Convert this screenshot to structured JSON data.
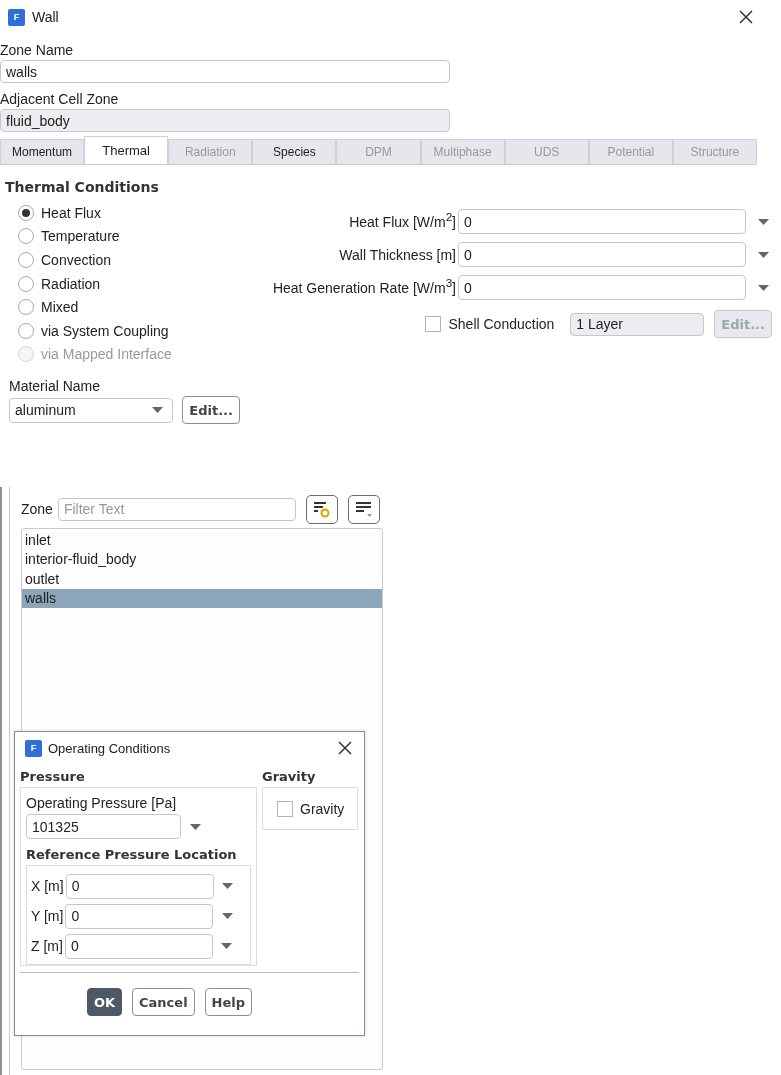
{
  "wall_dialog": {
    "logo": "F",
    "title": "Wall",
    "zone_name": {
      "label": "Zone Name",
      "value": "walls",
      "readonly": false
    },
    "adjacent_cell_zone": {
      "label": "Adjacent Cell Zone",
      "value": "fluid_body",
      "readonly": true
    },
    "tabs": [
      {
        "label": "Momentum",
        "selected": false,
        "disabled": false
      },
      {
        "label": "Thermal",
        "selected": true,
        "disabled": false
      },
      {
        "label": "Radiation",
        "selected": false,
        "disabled": true
      },
      {
        "label": "Species",
        "selected": false,
        "disabled": false
      },
      {
        "label": "DPM",
        "selected": false,
        "disabled": true
      },
      {
        "label": "Multiphase",
        "selected": false,
        "disabled": true
      },
      {
        "label": "UDS",
        "selected": false,
        "disabled": true
      },
      {
        "label": "Potential",
        "selected": false,
        "disabled": true
      },
      {
        "label": "Structure",
        "selected": false,
        "disabled": true
      }
    ],
    "section_title": "Thermal Conditions",
    "conditions": [
      {
        "label": "Heat Flux",
        "selected": true,
        "disabled": false
      },
      {
        "label": "Temperature",
        "selected": false,
        "disabled": false
      },
      {
        "label": "Convection",
        "selected": false,
        "disabled": false
      },
      {
        "label": "Radiation",
        "selected": false,
        "disabled": false
      },
      {
        "label": "Mixed",
        "selected": false,
        "disabled": false
      },
      {
        "label": "via System Coupling",
        "selected": false,
        "disabled": false
      },
      {
        "label": "via Mapped Interface",
        "selected": false,
        "disabled": true
      }
    ],
    "parameters": [
      {
        "label": "Heat Flux [W/m$^{2}$]",
        "value": "0"
      },
      {
        "label": "Wall Thickness [m]",
        "value": "0"
      },
      {
        "label": "Heat Generation Rate [W/m$^{3}$]",
        "value": "0"
      }
    ],
    "shell_conduction": {
      "label": "Shell Conduction",
      "checked": false,
      "layers": "1 Layer",
      "edit_button": {
        "label": "Edit...",
        "disabled": true
      }
    },
    "material": {
      "label": "Material Name",
      "value": "aluminum",
      "edit_button": {
        "label": "Edit...",
        "disabled": false
      }
    }
  },
  "zone_panel": {
    "label": "Zone",
    "filter_placeholder": "Filter Text",
    "items": [
      {
        "label": "inlet",
        "selected": false
      },
      {
        "label": "interior-fluid_body",
        "selected": false
      },
      {
        "label": "outlet",
        "selected": false
      },
      {
        "label": "walls",
        "selected": true
      }
    ]
  },
  "operating_conditions": {
    "logo": "F",
    "title": "Operating Conditions",
    "pressure_title": "Pressure",
    "operating_pressure": {
      "label": "Operating Pressure [Pa]",
      "value": "101325"
    },
    "reference_title": "Reference Pressure Location",
    "coordinates": [
      {
        "label": "X [m]",
        "value": "0"
      },
      {
        "label": "Y [m]",
        "value": "0"
      },
      {
        "label": "Z [m]",
        "value": "0"
      }
    ],
    "gravity_title": "Gravity",
    "gravity": {
      "label": "Gravity",
      "checked": false
    },
    "buttons": [
      {
        "label": "OK",
        "kind": "primary"
      },
      {
        "label": "Cancel",
        "kind": "default"
      },
      {
        "label": "Help",
        "kind": "default"
      }
    ]
  }
}
